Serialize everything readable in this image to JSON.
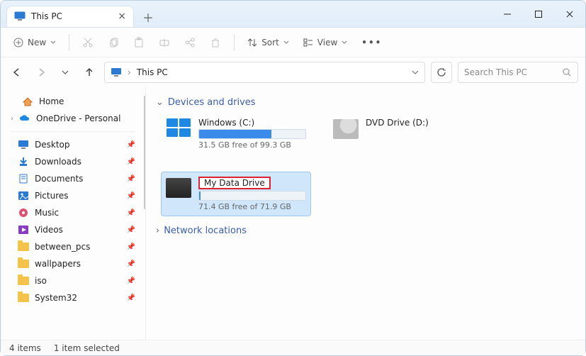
{
  "window": {
    "tab_title": "This PC",
    "new_btn": "New",
    "sort_btn": "Sort",
    "view_btn": "View"
  },
  "address": {
    "location": "This PC",
    "search_placeholder": "Search This PC"
  },
  "sidebar": {
    "home": "Home",
    "onedrive": "OneDrive - Personal",
    "items": [
      {
        "label": "Desktop"
      },
      {
        "label": "Downloads"
      },
      {
        "label": "Documents"
      },
      {
        "label": "Pictures"
      },
      {
        "label": "Music"
      },
      {
        "label": "Videos"
      },
      {
        "label": "between_pcs"
      },
      {
        "label": "wallpapers"
      },
      {
        "label": "iso"
      },
      {
        "label": "System32"
      }
    ]
  },
  "groups": {
    "devices": "Devices and drives",
    "network": "Network locations"
  },
  "drives": {
    "c": {
      "name": "Windows (C:)",
      "free_text": "31.5 GB free of 99.3 GB",
      "fill_pct": 68
    },
    "data": {
      "name": "My Data Drive",
      "free_text": "71.4 GB free of 71.9 GB",
      "fill_pct": 1
    },
    "dvd": {
      "name": "DVD Drive (D:)"
    }
  },
  "status": {
    "count": "4 items",
    "selected": "1 item selected"
  }
}
